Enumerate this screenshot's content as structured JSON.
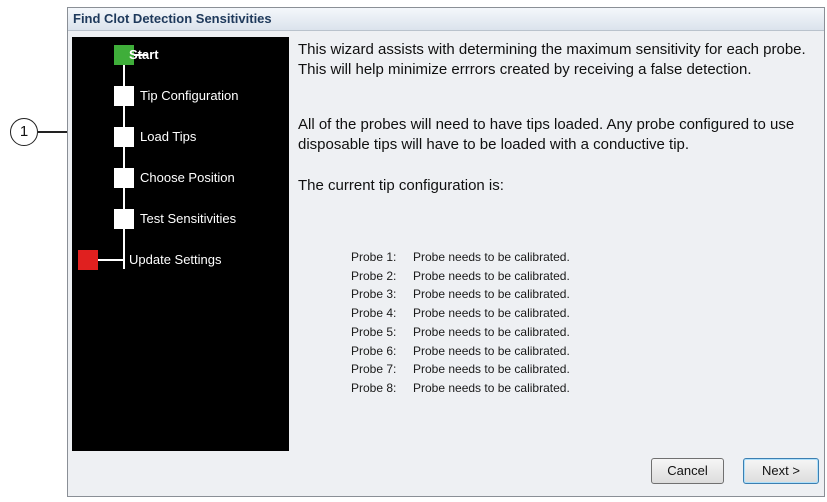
{
  "window": {
    "title": "Find Clot Detection Sensitivities"
  },
  "callout": {
    "number": "1"
  },
  "steps": [
    {
      "label": "Start",
      "marker": "green",
      "active": true
    },
    {
      "label": "Tip Configuration",
      "marker": "white"
    },
    {
      "label": "Load Tips",
      "marker": "white"
    },
    {
      "label": "Choose Position",
      "marker": "white"
    },
    {
      "label": "Test Sensitivities",
      "marker": "white"
    },
    {
      "label": "Update Settings",
      "marker": "red"
    }
  ],
  "content": {
    "intro": "This wizard assists with determining the maximum sensitivity for each probe.  This will help minimize errrors created by receiving a false detection.",
    "tips_note": "All of the probes will need to have tips loaded.  Any probe configured to use disposable tips will have to be loaded with a conductive tip.",
    "config_heading": "The current tip configuration is:",
    "probes": [
      {
        "name": "Probe 1:",
        "status": "Probe needs to be calibrated."
      },
      {
        "name": "Probe 2:",
        "status": "Probe needs to be calibrated."
      },
      {
        "name": "Probe 3:",
        "status": "Probe needs to be calibrated."
      },
      {
        "name": "Probe 4:",
        "status": "Probe needs to be calibrated."
      },
      {
        "name": "Probe 5:",
        "status": "Probe needs to be calibrated."
      },
      {
        "name": "Probe 6:",
        "status": "Probe needs to be calibrated."
      },
      {
        "name": "Probe 7:",
        "status": "Probe needs to be calibrated."
      },
      {
        "name": "Probe 8:",
        "status": "Probe needs to be calibrated."
      }
    ]
  },
  "buttons": {
    "cancel": "Cancel",
    "next": "Next >"
  },
  "colors": {
    "panel": "#000000",
    "start_marker": "#3fae3a",
    "end_marker": "#e0201f"
  }
}
